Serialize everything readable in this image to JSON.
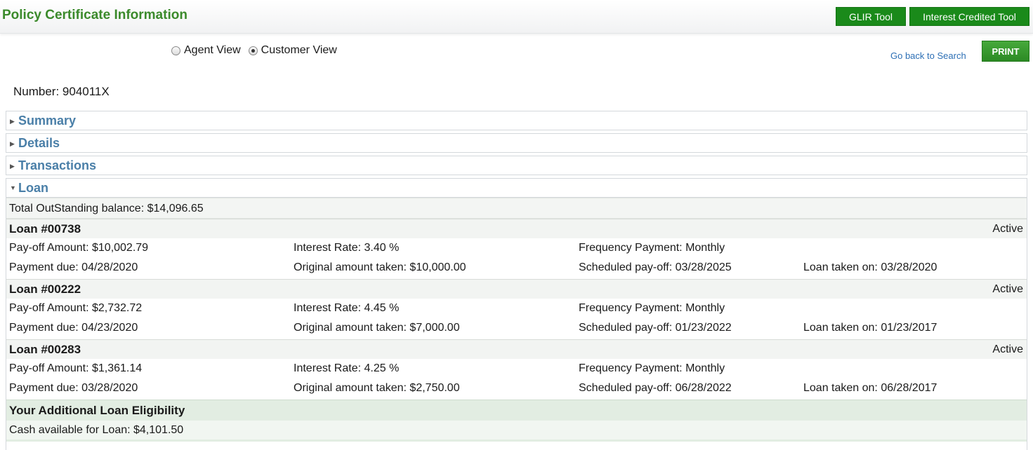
{
  "header": {
    "title": "Policy Certificate Information",
    "glir_label": "GLIR Tool",
    "interest_label": "Interest Credited Tool"
  },
  "view_toggle": {
    "agent_label": "Agent View",
    "customer_label": "Customer View",
    "selected": "Customer View"
  },
  "back_link": "Go back to Search",
  "print_label": "PRINT",
  "number_label": "Number: 904011X",
  "sections": [
    {
      "label": "Summary",
      "expanded": false
    },
    {
      "label": "Details",
      "expanded": false
    },
    {
      "label": "Transactions",
      "expanded": false
    },
    {
      "label": "Loan",
      "expanded": true
    }
  ],
  "loan": {
    "total_balance": "Total OutStanding balance: $14,096.65",
    "loans": [
      {
        "title": "Loan #00738",
        "status": "Active",
        "payoff": "Pay-off Amount: $10,002.79",
        "rate": "Interest Rate: 3.40 %",
        "frequency": "Frequency Payment: Monthly",
        "due": "Payment due: 04/28/2020",
        "original": "Original amount taken: $10,000.00",
        "scheduled": "Scheduled pay-off: 03/28/2025",
        "taken": "Loan taken on: 03/28/2020"
      },
      {
        "title": "Loan #00222",
        "status": "Active",
        "payoff": "Pay-off Amount: $2,732.72",
        "rate": "Interest Rate: 4.45 %",
        "frequency": "Frequency Payment: Monthly",
        "due": "Payment due: 04/23/2020",
        "original": "Original amount taken: $7,000.00",
        "scheduled": "Scheduled pay-off: 01/23/2022",
        "taken": "Loan taken on: 01/23/2017"
      },
      {
        "title": "Loan #00283",
        "status": "Active",
        "payoff": "Pay-off Amount: $1,361.14",
        "rate": "Interest Rate: 4.25 %",
        "frequency": "Frequency Payment: Monthly",
        "due": "Payment due: 03/28/2020",
        "original": "Original amount taken: $2,750.00",
        "scheduled": "Scheduled pay-off: 06/28/2022",
        "taken": "Loan taken on: 06/28/2017"
      }
    ],
    "eligibility_title": "Your Additional Loan Eligibility",
    "cash_available": "Cash available for Loan: $4,101.50"
  }
}
